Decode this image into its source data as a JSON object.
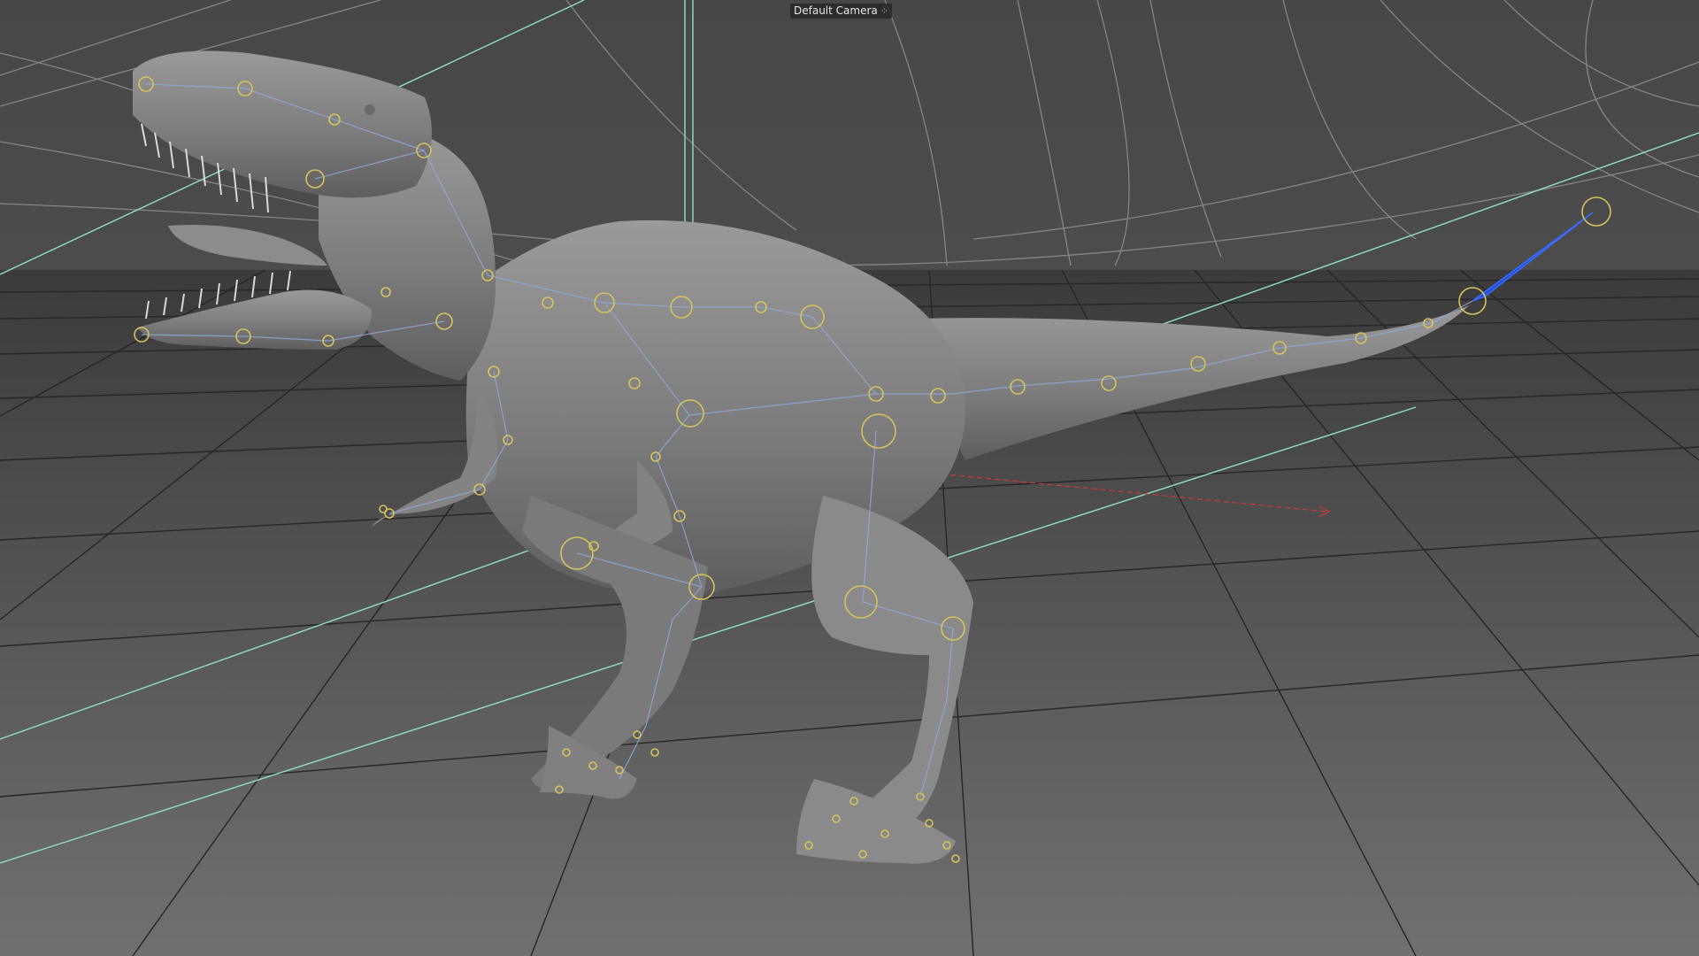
{
  "viewport": {
    "camera_label": "Default Camera",
    "camera_icon": "camera-dots-icon",
    "colors": {
      "background": "#474747",
      "floor_grid": "#2a2a2a",
      "sky_grid": "#9a9a9a",
      "helper_lines": "#8fe0c8",
      "joint_circles": "#d6c35a",
      "bone_lines": "#8fa8d8",
      "selected_bone": "#1f4fd6",
      "axis_x": "#d03a3a",
      "model": "#8a8a8a"
    }
  }
}
